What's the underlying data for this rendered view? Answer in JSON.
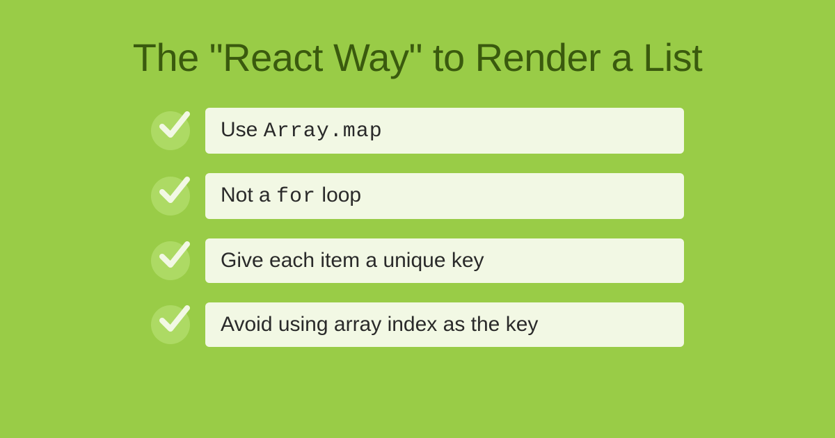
{
  "title": "The \"React Way\" to Render a List",
  "items": [
    {
      "segments": [
        {
          "text": "Use ",
          "code": false
        },
        {
          "text": "Array.map",
          "code": true
        }
      ]
    },
    {
      "segments": [
        {
          "text": "Not a ",
          "code": false
        },
        {
          "text": "for",
          "code": true
        },
        {
          "text": " loop",
          "code": false
        }
      ]
    },
    {
      "segments": [
        {
          "text": "Give each item a unique key",
          "code": false
        }
      ]
    },
    {
      "segments": [
        {
          "text": "Avoid using array index as the key",
          "code": false
        }
      ]
    }
  ],
  "colors": {
    "background": "#99cc47",
    "titleText": "#3a5a0e",
    "itemBg": "#f2f8e4",
    "checkCircle": "#adda64",
    "checkStroke": "#f2f8e4"
  }
}
